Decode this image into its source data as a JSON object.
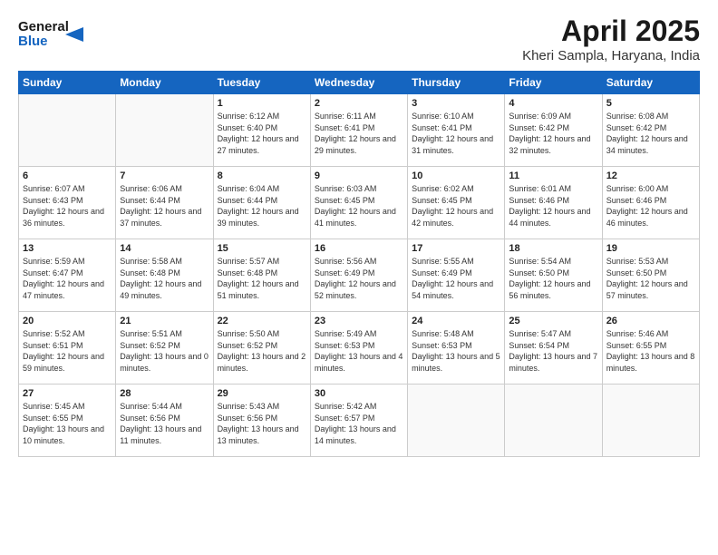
{
  "header": {
    "logo_line1": "General",
    "logo_line2": "Blue",
    "title": "April 2025",
    "subtitle": "Kheri Sampla, Haryana, India"
  },
  "days_of_week": [
    "Sunday",
    "Monday",
    "Tuesday",
    "Wednesday",
    "Thursday",
    "Friday",
    "Saturday"
  ],
  "weeks": [
    [
      {
        "num": "",
        "info": ""
      },
      {
        "num": "",
        "info": ""
      },
      {
        "num": "1",
        "info": "Sunrise: 6:12 AM\nSunset: 6:40 PM\nDaylight: 12 hours and 27 minutes."
      },
      {
        "num": "2",
        "info": "Sunrise: 6:11 AM\nSunset: 6:41 PM\nDaylight: 12 hours and 29 minutes."
      },
      {
        "num": "3",
        "info": "Sunrise: 6:10 AM\nSunset: 6:41 PM\nDaylight: 12 hours and 31 minutes."
      },
      {
        "num": "4",
        "info": "Sunrise: 6:09 AM\nSunset: 6:42 PM\nDaylight: 12 hours and 32 minutes."
      },
      {
        "num": "5",
        "info": "Sunrise: 6:08 AM\nSunset: 6:42 PM\nDaylight: 12 hours and 34 minutes."
      }
    ],
    [
      {
        "num": "6",
        "info": "Sunrise: 6:07 AM\nSunset: 6:43 PM\nDaylight: 12 hours and 36 minutes."
      },
      {
        "num": "7",
        "info": "Sunrise: 6:06 AM\nSunset: 6:44 PM\nDaylight: 12 hours and 37 minutes."
      },
      {
        "num": "8",
        "info": "Sunrise: 6:04 AM\nSunset: 6:44 PM\nDaylight: 12 hours and 39 minutes."
      },
      {
        "num": "9",
        "info": "Sunrise: 6:03 AM\nSunset: 6:45 PM\nDaylight: 12 hours and 41 minutes."
      },
      {
        "num": "10",
        "info": "Sunrise: 6:02 AM\nSunset: 6:45 PM\nDaylight: 12 hours and 42 minutes."
      },
      {
        "num": "11",
        "info": "Sunrise: 6:01 AM\nSunset: 6:46 PM\nDaylight: 12 hours and 44 minutes."
      },
      {
        "num": "12",
        "info": "Sunrise: 6:00 AM\nSunset: 6:46 PM\nDaylight: 12 hours and 46 minutes."
      }
    ],
    [
      {
        "num": "13",
        "info": "Sunrise: 5:59 AM\nSunset: 6:47 PM\nDaylight: 12 hours and 47 minutes."
      },
      {
        "num": "14",
        "info": "Sunrise: 5:58 AM\nSunset: 6:48 PM\nDaylight: 12 hours and 49 minutes."
      },
      {
        "num": "15",
        "info": "Sunrise: 5:57 AM\nSunset: 6:48 PM\nDaylight: 12 hours and 51 minutes."
      },
      {
        "num": "16",
        "info": "Sunrise: 5:56 AM\nSunset: 6:49 PM\nDaylight: 12 hours and 52 minutes."
      },
      {
        "num": "17",
        "info": "Sunrise: 5:55 AM\nSunset: 6:49 PM\nDaylight: 12 hours and 54 minutes."
      },
      {
        "num": "18",
        "info": "Sunrise: 5:54 AM\nSunset: 6:50 PM\nDaylight: 12 hours and 56 minutes."
      },
      {
        "num": "19",
        "info": "Sunrise: 5:53 AM\nSunset: 6:50 PM\nDaylight: 12 hours and 57 minutes."
      }
    ],
    [
      {
        "num": "20",
        "info": "Sunrise: 5:52 AM\nSunset: 6:51 PM\nDaylight: 12 hours and 59 minutes."
      },
      {
        "num": "21",
        "info": "Sunrise: 5:51 AM\nSunset: 6:52 PM\nDaylight: 13 hours and 0 minutes."
      },
      {
        "num": "22",
        "info": "Sunrise: 5:50 AM\nSunset: 6:52 PM\nDaylight: 13 hours and 2 minutes."
      },
      {
        "num": "23",
        "info": "Sunrise: 5:49 AM\nSunset: 6:53 PM\nDaylight: 13 hours and 4 minutes."
      },
      {
        "num": "24",
        "info": "Sunrise: 5:48 AM\nSunset: 6:53 PM\nDaylight: 13 hours and 5 minutes."
      },
      {
        "num": "25",
        "info": "Sunrise: 5:47 AM\nSunset: 6:54 PM\nDaylight: 13 hours and 7 minutes."
      },
      {
        "num": "26",
        "info": "Sunrise: 5:46 AM\nSunset: 6:55 PM\nDaylight: 13 hours and 8 minutes."
      }
    ],
    [
      {
        "num": "27",
        "info": "Sunrise: 5:45 AM\nSunset: 6:55 PM\nDaylight: 13 hours and 10 minutes."
      },
      {
        "num": "28",
        "info": "Sunrise: 5:44 AM\nSunset: 6:56 PM\nDaylight: 13 hours and 11 minutes."
      },
      {
        "num": "29",
        "info": "Sunrise: 5:43 AM\nSunset: 6:56 PM\nDaylight: 13 hours and 13 minutes."
      },
      {
        "num": "30",
        "info": "Sunrise: 5:42 AM\nSunset: 6:57 PM\nDaylight: 13 hours and 14 minutes."
      },
      {
        "num": "",
        "info": ""
      },
      {
        "num": "",
        "info": ""
      },
      {
        "num": "",
        "info": ""
      }
    ]
  ]
}
